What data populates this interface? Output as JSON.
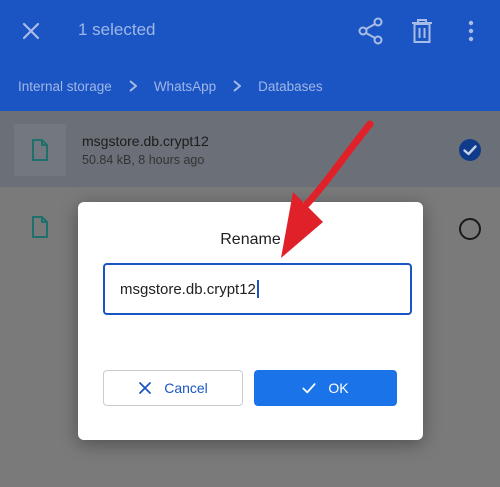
{
  "appbar": {
    "title": "1 selected",
    "icons": [
      "close-icon",
      "share-icon",
      "delete-icon",
      "more-vert-icon"
    ]
  },
  "breadcrumb": {
    "items": [
      "Internal storage",
      "WhatsApp",
      "Databases"
    ]
  },
  "files": [
    {
      "name": "msgstore.db.crypt12",
      "meta": "50.84 kB, 8 hours ago",
      "selected": true
    },
    {
      "name": "",
      "meta": "",
      "selected": false
    }
  ],
  "dialog": {
    "title": "Rename",
    "field_value": "msgstore.db.crypt12",
    "cancel_label": "Cancel",
    "ok_label": "OK"
  },
  "colors": {
    "appbar": "#1b55c4",
    "accent": "#1a73e8",
    "annotation_arrow": "#e0212a"
  }
}
